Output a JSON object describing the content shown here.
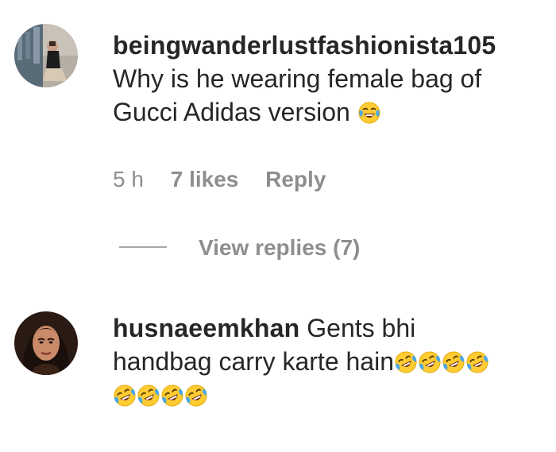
{
  "comments": [
    {
      "username": "beingwanderlustfashionista105",
      "text_line1": "Why is he wearing female bag of",
      "text_line2": "Gucci Adidas version",
      "emoji": "face-with-tears-of-joy",
      "time": "5 h",
      "likes": "7 likes",
      "reply_label": "Reply",
      "view_replies": "View replies (7)"
    },
    {
      "username": "husnaeemkhan",
      "text_line1": "Gents bhi",
      "text_line2": "handbag carry karte hain",
      "emoji": "rolling-on-the-floor-laughing",
      "emoji_count_line2": 4,
      "emoji_count_line3": 4
    }
  ],
  "colors": {
    "text": "#262626",
    "meta": "#8e8e8e",
    "emoji_face": "#ffcc33",
    "emoji_tear": "#4aa8e8"
  }
}
